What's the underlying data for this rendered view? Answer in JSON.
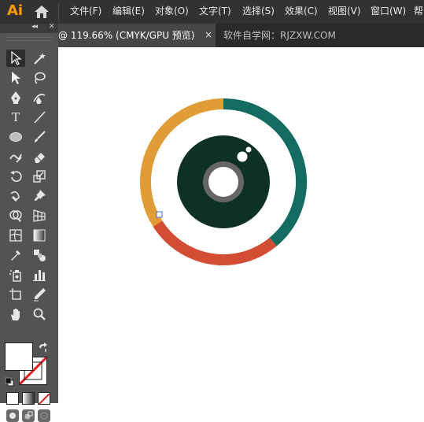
{
  "menubar": {
    "app_logo": "Ai",
    "items": [
      "文件(F)",
      "编辑(E)",
      "对象(O)",
      "文字(T)",
      "选择(S)",
      "效果(C)",
      "视图(V)",
      "窗口(W)",
      "帮"
    ]
  },
  "tabs": {
    "active_label": "@ 119.66% (CMYK/GPU 预览)",
    "close_label": "×",
    "other_label": "软件自学网：RJZXW.COM"
  },
  "tools": {
    "type_tool_label": "T"
  },
  "colors": {
    "menubar": "#323232",
    "panel": "#535353",
    "ring_teal": "#136b61",
    "ring_orange": "#e09c37",
    "ring_red": "#d24d34",
    "lens_dark": "#0f3024",
    "lens_gray": "#666666",
    "app_accent": "#ff9a00"
  },
  "artwork": {
    "ring_segments": [
      {
        "name": "teal",
        "color": "#136b61",
        "share": 0.39
      },
      {
        "name": "red",
        "color": "#d24d34",
        "share": 0.27
      },
      {
        "name": "orange",
        "color": "#e09c37",
        "share": 0.34
      }
    ]
  }
}
